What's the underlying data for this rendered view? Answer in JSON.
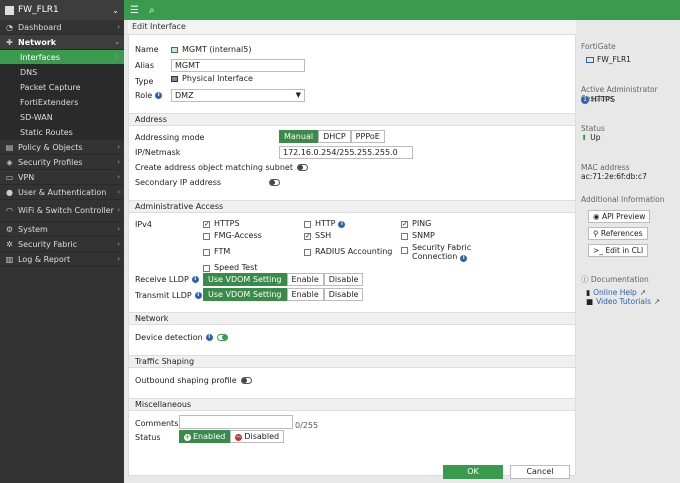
{
  "sidebar": {
    "device": "FW_FLR1",
    "items": [
      {
        "label": "Dashboard",
        "icon": "dashboard-icon",
        "glyph": "◔",
        "chev": "›"
      },
      {
        "label": "Network",
        "icon": "network-icon",
        "glyph": "✚",
        "chev": "⌄"
      },
      {
        "label": "Interfaces",
        "icon": "",
        "glyph": "",
        "chev": "☆"
      },
      {
        "label": "DNS",
        "icon": "",
        "glyph": "",
        "chev": ""
      },
      {
        "label": "Packet Capture",
        "icon": "",
        "glyph": "",
        "chev": ""
      },
      {
        "label": "FortiExtenders",
        "icon": "",
        "glyph": "",
        "chev": ""
      },
      {
        "label": "SD-WAN",
        "icon": "",
        "glyph": "",
        "chev": ""
      },
      {
        "label": "Static Routes",
        "icon": "",
        "glyph": "",
        "chev": ""
      },
      {
        "label": "Policy & Objects",
        "icon": "policy-icon",
        "glyph": "▤",
        "chev": "›"
      },
      {
        "label": "Security Profiles",
        "icon": "security-profiles-icon",
        "glyph": "◈",
        "chev": "›"
      },
      {
        "label": "VPN",
        "icon": "vpn-icon",
        "glyph": "▭",
        "chev": "›"
      },
      {
        "label": "User & Authentication",
        "icon": "user-icon",
        "glyph": "●",
        "chev": "›"
      },
      {
        "label": "WiFi & Switch Controller",
        "icon": "wifi-icon",
        "glyph": "◠",
        "chev": "›"
      },
      {
        "label": "System",
        "icon": "system-icon",
        "glyph": "⚙",
        "chev": "›"
      },
      {
        "label": "Security Fabric",
        "icon": "fabric-icon",
        "glyph": "✲",
        "chev": "›"
      },
      {
        "label": "Log & Report",
        "icon": "log-icon",
        "glyph": "▥",
        "chev": "›"
      }
    ]
  },
  "topbar": {
    "menu_glyph": "☰",
    "search_glyph": "🔍"
  },
  "page": {
    "title": "Edit Interface"
  },
  "form": {
    "name_label": "Name",
    "name_value": "MGMT (internal5)",
    "alias_label": "Alias",
    "alias_value": "MGMT",
    "type_label": "Type",
    "type_value": "Physical Interface",
    "role_label": "Role",
    "role_value": "DMZ",
    "address_section": "Address",
    "addressing_mode_label": "Addressing mode",
    "addressing_modes": [
      "Manual",
      "DHCP",
      "PPPoE"
    ],
    "ip_label": "IP/Netmask",
    "ip_value": "172.16.0.254/255.255.255.0",
    "create_address_label": "Create address object matching subnet",
    "secondary_ip_label": "Secondary IP address",
    "admin_section": "Administrative Access",
    "ipv4_label": "IPv4",
    "access": {
      "https": "HTTPS",
      "http": "HTTP",
      "ping": "PING",
      "fmg": "FMG-Access",
      "ssh": "SSH",
      "snmp": "SNMP",
      "ftm": "FTM",
      "radius": "RADIUS Accounting",
      "fabric_1": "Security Fabric",
      "fabric_2": "Connection",
      "speed": "Speed Test"
    },
    "receive_lldp_label": "Receive LLDP",
    "transmit_lldp_label": "Transmit LLDP",
    "lldp_options": [
      "Use VDOM Setting",
      "Enable",
      "Disable"
    ],
    "network_section": "Network",
    "device_detection_label": "Device detection",
    "traffic_section": "Traffic Shaping",
    "outbound_label": "Outbound shaping profile",
    "misc_section": "Miscellaneous",
    "comments_label": "Comments",
    "comments_count": "0/255",
    "status_label": "Status",
    "status_enabled": "Enabled",
    "status_disabled": "Disabled"
  },
  "footer": {
    "ok": "OK",
    "cancel": "Cancel"
  },
  "right": {
    "fortigate_title": "FortiGate",
    "fortigate_value": "FW_FLR1",
    "sessions_title": "Active Administrator Sessions",
    "sessions_value": "HTTPS",
    "sessions_count": "1",
    "status_title": "Status",
    "status_value": "Up",
    "mac_title": "MAC address",
    "mac_value": "ac:71:2e:6f:db:c7",
    "additional_title": "Additional Information",
    "api_preview": "API Preview",
    "references": "References",
    "edit_cli": "Edit in CLI",
    "documentation_title": "Documentation",
    "online_help": "Online Help",
    "video_tutorials": "Video Tutorials"
  },
  "colors": {
    "accent": "#3a9b4f",
    "sidebar": "#333333",
    "info": "#2e62b0"
  }
}
